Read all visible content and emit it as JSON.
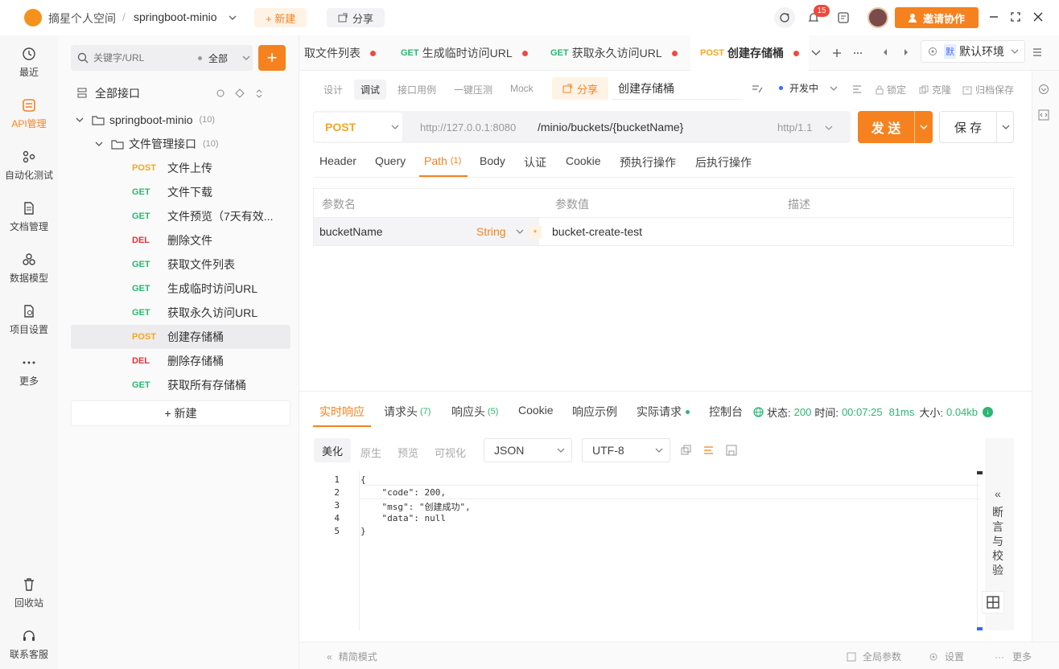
{
  "topbar": {
    "workspace": "摘星个人空间",
    "separator": "/",
    "project": "springboot-minio",
    "new_label": "+ 新建",
    "share_label": "分享",
    "notif_count": "15",
    "invite_label": "邀请协作"
  },
  "leftnav": [
    {
      "label": "最近",
      "icon": "clock-icon"
    },
    {
      "label": "API管理",
      "icon": "api-icon"
    },
    {
      "label": "自动化测试",
      "icon": "automation-icon"
    },
    {
      "label": "文档管理",
      "icon": "document-icon"
    },
    {
      "label": "数据模型",
      "icon": "data-model-icon"
    },
    {
      "label": "项目设置",
      "icon": "project-settings-icon"
    },
    {
      "label": "更多",
      "icon": "more-icon"
    },
    {
      "label": "回收站",
      "icon": "trash-icon"
    },
    {
      "label": "联系客服",
      "icon": "headset-icon"
    }
  ],
  "tree": {
    "search_placeholder": "关键字/URL",
    "filter": "全部",
    "root": "全部接口",
    "project": "springboot-minio",
    "project_count": "(10)",
    "folder": "文件管理接口",
    "folder_count": "(10)",
    "items": [
      {
        "method": "POST",
        "name": "文件上传"
      },
      {
        "method": "GET",
        "name": "文件下载"
      },
      {
        "method": "GET",
        "name": "文件预览（7天有效..."
      },
      {
        "method": "DEL",
        "name": "删除文件"
      },
      {
        "method": "GET",
        "name": "获取文件列表"
      },
      {
        "method": "GET",
        "name": "生成临时访问URL"
      },
      {
        "method": "GET",
        "name": "获取永久访问URL"
      },
      {
        "method": "POST",
        "name": "创建存储桶"
      },
      {
        "method": "DEL",
        "name": "删除存储桶"
      },
      {
        "method": "GET",
        "name": "获取所有存储桶"
      }
    ],
    "new_label": "+ 新建"
  },
  "tabs": [
    {
      "method": "",
      "name": "取文件列表"
    },
    {
      "method": "GET",
      "name": "生成临时访问URL"
    },
    {
      "method": "GET",
      "name": "获取永久访问URL"
    },
    {
      "method": "POST",
      "name": "创建存储桶"
    }
  ],
  "env": {
    "badge": "默",
    "label": "默认环境"
  },
  "subtabs": [
    "设计",
    "调试",
    "接口用例",
    "一键压测",
    "Mock"
  ],
  "share_label": "分享",
  "request_name": "创建存储桶",
  "status_label": "开发中",
  "lock_label": "锁定",
  "clone_label": "克隆",
  "archive_label": "归档保存",
  "url": {
    "method": "POST",
    "host": "http://127.0.0.1:8080",
    "path": "/minio/buckets/{bucketName}",
    "protocol": "http/1.1",
    "send_label": "发 送",
    "save_label": "保 存"
  },
  "request_tabs": [
    "Header",
    "Query",
    "Path",
    "(1)",
    "Body",
    "认证",
    "Cookie",
    "预执行操作",
    "后执行操作"
  ],
  "params": {
    "headers": [
      "参数名",
      "参数值",
      "描述"
    ],
    "row": {
      "name": "bucketName",
      "type": "String",
      "required": "*",
      "value": "bucket-create-test"
    }
  },
  "response": {
    "tabs": [
      "实时响应",
      "请求头",
      "(7)",
      "响应头",
      "(5)",
      "Cookie",
      "响应示例",
      "实际请求",
      "控制台"
    ],
    "status_label": "状态:",
    "status_code": "200",
    "time_label": "时间:",
    "time_value": "00:07:25",
    "duration": "81ms",
    "size_label": "大小:",
    "size_value": "0.04kb",
    "view_tabs": [
      "美化",
      "原生",
      "预览",
      "可视化"
    ],
    "format": "JSON",
    "encoding": "UTF-8",
    "code_lines": [
      "{",
      "    \"code\": 200,",
      "    \"msg\": \"创建成功\",",
      "    \"data\": null",
      "}"
    ],
    "line_numbers": [
      "1",
      "2",
      "3",
      "4",
      "5"
    ],
    "side_panel": [
      "断",
      "言",
      "与",
      "校",
      "验"
    ]
  },
  "bottombar": {
    "simple_mode": "精简模式",
    "global_params": "全局参数",
    "settings": "设置",
    "more": "更多"
  },
  "colors": {
    "accent": "#f5821f",
    "post": "#f5a623",
    "get": "#2bb673",
    "del": "#e5333a"
  }
}
